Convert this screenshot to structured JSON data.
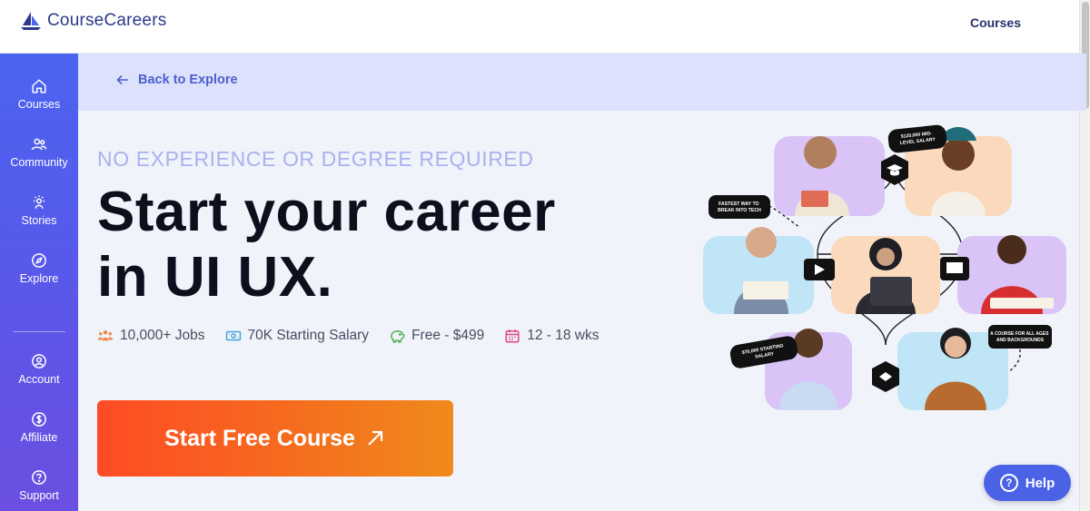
{
  "header": {
    "logo_text": "CourseCareers",
    "nav_courses": "Courses"
  },
  "sidebar": {
    "items": [
      {
        "label": "Courses",
        "icon": "home-icon"
      },
      {
        "label": "Community",
        "icon": "community-icon"
      },
      {
        "label": "Stories",
        "icon": "stories-icon"
      },
      {
        "label": "Explore",
        "icon": "compass-icon"
      },
      {
        "label": "Account",
        "icon": "account-icon"
      },
      {
        "label": "Affiliate",
        "icon": "dollar-icon"
      },
      {
        "label": "Support",
        "icon": "question-icon"
      }
    ]
  },
  "backbar": {
    "back_label": "Back to Explore"
  },
  "hero": {
    "kicker": "NO EXPERIENCE OR DEGREE REQUIRED",
    "headline_line1": "Start your career",
    "headline_line2": "in UI UX.",
    "stats": [
      {
        "label": "10,000+ Jobs",
        "icon": "people-icon"
      },
      {
        "label": "70K Starting Salary",
        "icon": "money-icon"
      },
      {
        "label": "Free - $499",
        "icon": "piggy-bank-icon"
      },
      {
        "label": "12 - 18 wks",
        "icon": "calendar-icon"
      }
    ],
    "cta_label": "Start Free Course",
    "illustration": {
      "tag_salary_mid": "$120,000 MID-LEVEL SALARY",
      "tag_fastest": "FASTEST WAY TO BREAK INTO TECH",
      "tag_starting": "$70,000 STARTING SALARY",
      "tag_all_ages": "A COURSE FOR ALL AGES AND BACKGROUNDS"
    }
  },
  "help": {
    "label": "Help"
  },
  "colors": {
    "brand": "#2b3a8c",
    "sidebar": "#4b64f0",
    "cta_start": "#ff4b24",
    "cta_end": "#ef8a1c",
    "kicker": "#a9b2ee"
  }
}
